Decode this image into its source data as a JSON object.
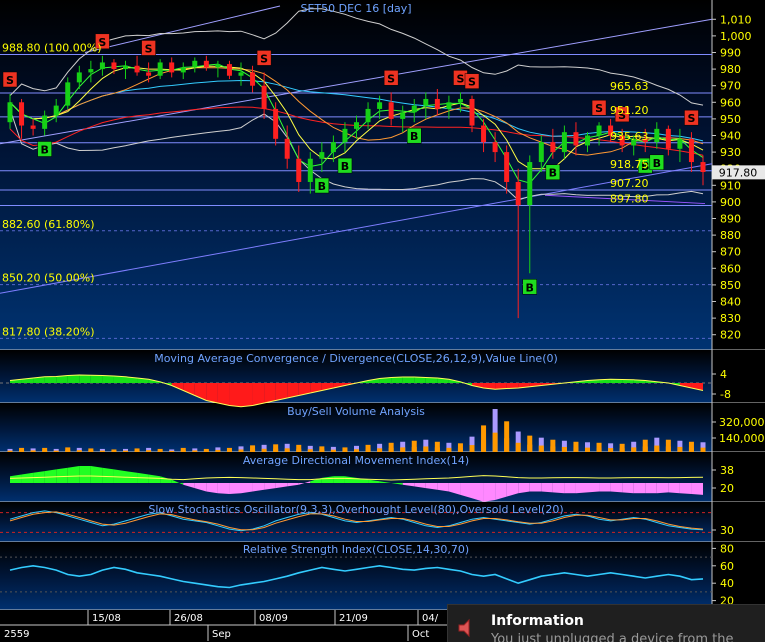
{
  "chart_title": "SET50 DEC 16   [day]",
  "last_price": "917.80",
  "colors": {
    "bull": "#16d016",
    "bear": "#ff2020",
    "macd_pos": "#18e018",
    "macd_neg": "#ff1a1a",
    "adx_pos": "#22ff22",
    "adx_neg": "#ff88ff",
    "buy_tag": "#1fdd1f",
    "sell_tag": "#ee3322",
    "axis_text": "#ffff00"
  },
  "chart_data": [
    {
      "type": "candlestick",
      "title": "SET50 DEC 16   [day]",
      "ylim": [
        812,
        1018
      ],
      "y_ticks": [
        1010,
        1000,
        990,
        980,
        970,
        960,
        950,
        940,
        930,
        920,
        910,
        900,
        890,
        880,
        870,
        860,
        850,
        840,
        830,
        820
      ],
      "fibonacci_levels": [
        {
          "label": "988.80 (100.00%)",
          "value": 988.8
        },
        {
          "label": "882.60 (61.80%)",
          "value": 882.6
        },
        {
          "label": "850.20 (50.00%)",
          "value": 850.2
        },
        {
          "label": "817.80 (38.20%)",
          "value": 817.8
        }
      ],
      "price_labels": [
        {
          "label": "965.63",
          "value": 965.63
        },
        {
          "label": "951.20",
          "value": 951.2
        },
        {
          "label": "935.63",
          "value": 935.63
        },
        {
          "label": "918.75",
          "value": 918.75
        },
        {
          "label": "907.20",
          "value": 907.2
        },
        {
          "label": "897.80",
          "value": 897.8
        }
      ],
      "last_price": 917.8,
      "candles": [
        [
          948,
          965,
          944,
          960
        ],
        [
          960,
          962,
          938,
          946
        ],
        [
          946,
          950,
          940,
          944
        ],
        [
          944,
          955,
          940,
          952
        ],
        [
          952,
          962,
          948,
          958
        ],
        [
          958,
          975,
          956,
          972
        ],
        [
          972,
          982,
          968,
          978
        ],
        [
          978,
          985,
          972,
          980
        ],
        [
          980,
          988,
          976,
          984
        ],
        [
          984,
          986,
          977,
          980
        ],
        [
          980,
          985,
          974,
          982
        ],
        [
          982,
          988,
          976,
          978
        ],
        [
          978,
          984,
          972,
          976
        ],
        [
          976,
          986,
          974,
          984
        ],
        [
          984,
          987,
          975,
          978
        ],
        [
          978,
          984,
          974,
          981
        ],
        [
          981,
          987,
          978,
          985
        ],
        [
          985,
          988,
          979,
          981
        ],
        [
          981,
          985,
          975,
          983
        ],
        [
          983,
          985,
          974,
          976
        ],
        [
          976,
          984,
          970,
          978
        ],
        [
          978,
          982,
          966,
          970
        ],
        [
          970,
          978,
          950,
          956
        ],
        [
          956,
          960,
          934,
          938
        ],
        [
          938,
          946,
          920,
          926
        ],
        [
          926,
          934,
          906,
          912
        ],
        [
          912,
          930,
          905,
          926
        ],
        [
          926,
          936,
          918,
          930
        ],
        [
          930,
          940,
          924,
          936
        ],
        [
          936,
          948,
          930,
          944
        ],
        [
          944,
          952,
          938,
          948
        ],
        [
          948,
          960,
          944,
          956
        ],
        [
          956,
          964,
          950,
          960
        ],
        [
          960,
          966,
          946,
          950
        ],
        [
          950,
          958,
          942,
          954
        ],
        [
          954,
          962,
          948,
          958
        ],
        [
          958,
          966,
          950,
          962
        ],
        [
          962,
          968,
          952,
          956
        ],
        [
          956,
          964,
          950,
          960
        ],
        [
          960,
          966,
          954,
          962
        ],
        [
          962,
          964,
          942,
          946
        ],
        [
          946,
          950,
          930,
          936
        ],
        [
          936,
          942,
          924,
          930
        ],
        [
          930,
          934,
          905,
          912
        ],
        [
          912,
          920,
          830,
          898
        ],
        [
          898,
          928,
          857,
          924
        ],
        [
          924,
          940,
          918,
          936
        ],
        [
          936,
          944,
          926,
          930
        ],
        [
          930,
          946,
          926,
          942
        ],
        [
          942,
          948,
          928,
          934
        ],
        [
          934,
          942,
          930,
          940
        ],
        [
          940,
          948,
          934,
          946
        ],
        [
          946,
          950,
          936,
          940
        ],
        [
          940,
          944,
          930,
          934
        ],
        [
          934,
          940,
          928,
          938
        ],
        [
          938,
          944,
          930,
          936
        ],
        [
          936,
          948,
          932,
          944
        ],
        [
          944,
          946,
          928,
          932
        ],
        [
          932,
          944,
          924,
          938
        ],
        [
          938,
          942,
          918,
          924
        ],
        [
          924,
          928,
          910,
          918
        ]
      ],
      "signals": [
        {
          "i": 0,
          "type": "S"
        },
        {
          "i": 3,
          "type": "B"
        },
        {
          "i": 8,
          "type": "S"
        },
        {
          "i": 12,
          "type": "S"
        },
        {
          "i": 22,
          "type": "S"
        },
        {
          "i": 27,
          "type": "B"
        },
        {
          "i": 29,
          "type": "B"
        },
        {
          "i": 33,
          "type": "S"
        },
        {
          "i": 35,
          "type": "B"
        },
        {
          "i": 39,
          "type": "S"
        },
        {
          "i": 40,
          "type": "S"
        },
        {
          "i": 45,
          "type": "B"
        },
        {
          "i": 47,
          "type": "B"
        },
        {
          "i": 51,
          "type": "S"
        },
        {
          "i": 53,
          "type": "S"
        },
        {
          "i": 55,
          "type": "B"
        },
        {
          "i": 56,
          "type": "B"
        },
        {
          "i": 59,
          "type": "S"
        }
      ]
    },
    {
      "type": "area",
      "title": "Moving Average Convergence / Divergence(CLOSE,26,12,9),Value Line(0)",
      "y_ticks": [
        4,
        -8
      ],
      "values": [
        1,
        1.5,
        2,
        2.5,
        2.6,
        3,
        3.2,
        3.1,
        3,
        2.8,
        2.5,
        2,
        1.5,
        0.5,
        -1,
        -3,
        -5,
        -7,
        -8,
        -9,
        -9.5,
        -9,
        -8,
        -7,
        -6,
        -5,
        -4,
        -3,
        -2,
        -1,
        0,
        1,
        1.8,
        2.2,
        2.4,
        2.4,
        2.2,
        2,
        1.5,
        0.5,
        -1,
        -2,
        -2.5,
        -2.2,
        -2,
        -1.5,
        -1,
        -0.5,
        0,
        0.5,
        1,
        1.3,
        1.5,
        1.4,
        1.3,
        1,
        0.5,
        0,
        -1,
        -2,
        -3
      ]
    },
    {
      "type": "bar",
      "title": "Buy/Sell Volume Analysis",
      "y_ticks": [
        320000,
        140000
      ],
      "values": [
        30,
        40,
        35,
        40,
        30,
        45,
        40,
        35,
        30,
        25,
        30,
        35,
        40,
        30,
        25,
        40,
        35,
        30,
        45,
        40,
        55,
        65,
        70,
        75,
        80,
        70,
        60,
        55,
        50,
        45,
        60,
        70,
        80,
        90,
        100,
        110,
        120,
        100,
        90,
        85,
        150,
        260,
        420,
        300,
        200,
        160,
        140,
        120,
        110,
        100,
        95,
        90,
        85,
        80,
        100,
        120,
        140,
        120,
        110,
        100,
        95
      ]
    },
    {
      "type": "area",
      "title": "Average Directional Movement Index(14)",
      "y_ticks": [
        38,
        20
      ],
      "values": [
        8,
        10,
        12,
        14,
        16,
        18,
        20,
        20,
        18,
        16,
        14,
        12,
        10,
        8,
        4,
        -2,
        -6,
        -10,
        -12,
        -13,
        -12,
        -10,
        -8,
        -6,
        -4,
        -2,
        2,
        6,
        8,
        8,
        6,
        4,
        2,
        0,
        -2,
        -4,
        -6,
        -8,
        -10,
        -14,
        -18,
        -22,
        -20,
        -16,
        -12,
        -10,
        -10,
        -11,
        -12,
        -12,
        -11,
        -10,
        -10,
        -11,
        -12,
        -12,
        -12,
        -11,
        -12,
        -13,
        -14
      ]
    },
    {
      "type": "line",
      "title": "Slow Stochastics Oscillator(9,3,3),Overhought Level(80),Oversold Level(20)",
      "y_ticks": [
        30
      ],
      "series": [
        {
          "values": [
            60,
            70,
            80,
            85,
            80,
            70,
            60,
            50,
            40,
            45,
            55,
            65,
            75,
            80,
            70,
            60,
            55,
            50,
            40,
            30,
            25,
            30,
            40,
            55,
            65,
            75,
            80,
            75,
            65,
            55,
            50,
            55,
            60,
            65,
            60,
            50,
            40,
            35,
            40,
            50,
            60,
            65,
            60,
            55,
            50,
            45,
            50,
            60,
            70,
            75,
            70,
            60,
            55,
            60,
            65,
            60,
            50,
            40,
            35,
            30,
            28
          ]
        },
        {
          "values": [
            55,
            65,
            75,
            80,
            82,
            75,
            65,
            55,
            45,
            42,
            48,
            58,
            68,
            76,
            74,
            65,
            58,
            52,
            45,
            35,
            28,
            28,
            35,
            48,
            58,
            68,
            76,
            76,
            70,
            60,
            53,
            53,
            58,
            62,
            62,
            55,
            45,
            38,
            38,
            45,
            55,
            62,
            62,
            58,
            52,
            48,
            48,
            55,
            65,
            72,
            72,
            65,
            58,
            58,
            62,
            62,
            55,
            45,
            38,
            33,
            30
          ]
        }
      ]
    },
    {
      "type": "line",
      "title": "Relative Strength Index(CLOSE,14,30,70)",
      "y_ticks": [
        80,
        60,
        40,
        20
      ],
      "values": [
        55,
        58,
        60,
        58,
        55,
        50,
        48,
        50,
        55,
        58,
        56,
        52,
        50,
        48,
        45,
        42,
        40,
        38,
        36,
        35,
        38,
        40,
        42,
        45,
        48,
        52,
        55,
        58,
        56,
        54,
        56,
        58,
        60,
        58,
        56,
        55,
        57,
        58,
        56,
        54,
        50,
        48,
        50,
        45,
        40,
        44,
        48,
        50,
        52,
        50,
        48,
        50,
        52,
        50,
        48,
        46,
        48,
        50,
        48,
        44,
        45
      ]
    }
  ],
  "x_labels": [
    "15/08",
    "26/08",
    "08/09",
    "21/09",
    "04/"
  ],
  "x_bottom_labels": [
    "2559",
    "Sep",
    "Oct"
  ],
  "toast": {
    "title": "Information",
    "message": "You just unplugged a device from the"
  }
}
